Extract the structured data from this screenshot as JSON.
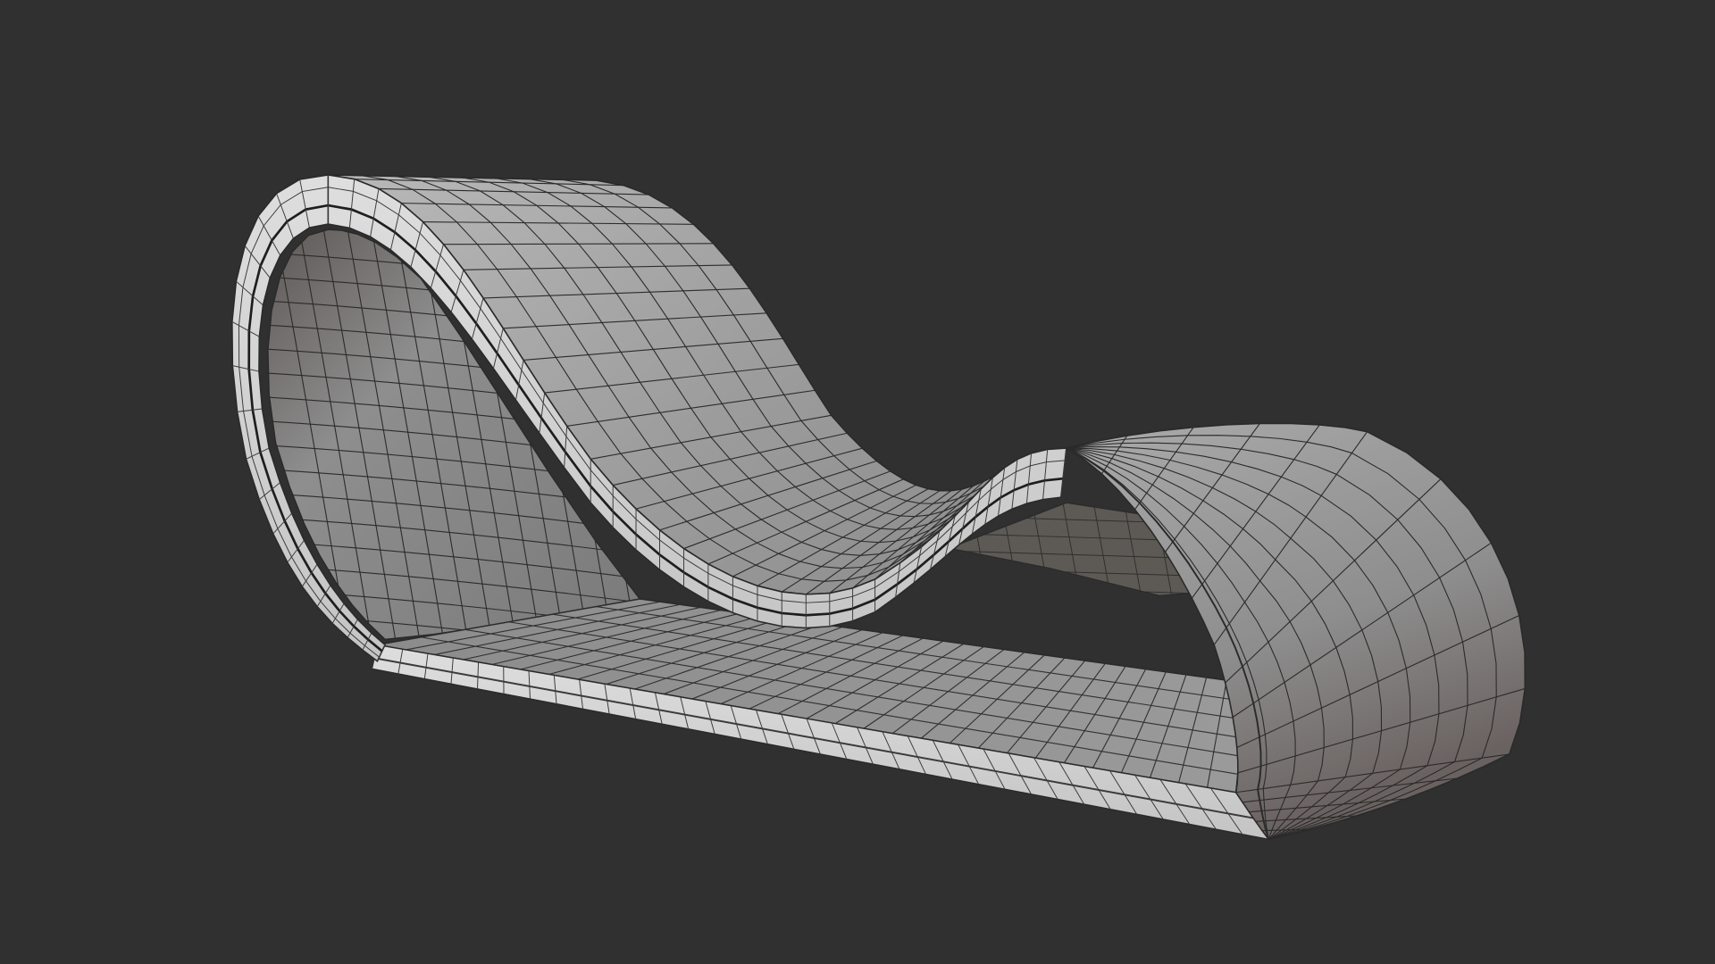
{
  "viewport": {
    "background": "#303030",
    "object": "wave-chaise-lounge-mesh",
    "shading": "wireframe-on-solid",
    "colors": {
      "surface_light": "#c9c9c9",
      "surface_mid": "#9e9e9e",
      "surface_dark": "#6e6e6e",
      "rim": "#d6d6d6",
      "wire": "#2a2a2a"
    }
  }
}
